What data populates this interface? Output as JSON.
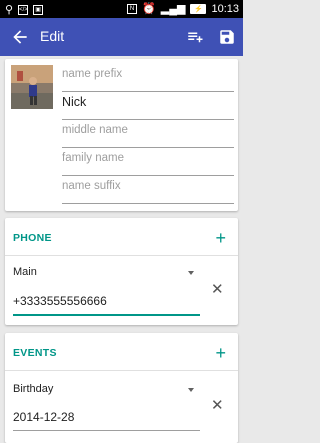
{
  "status": {
    "time": "10:13"
  },
  "toolbar": {
    "title": "Edit"
  },
  "name": {
    "prefix_placeholder": "name prefix",
    "first_value": "Nick",
    "middle_placeholder": "middle name",
    "family_placeholder": "family name",
    "suffix_placeholder": "name suffix"
  },
  "phone": {
    "title": "PHONE",
    "type": "Main",
    "value": "+3333555556666"
  },
  "events": {
    "title": "EVENTS",
    "type": "Birthday",
    "value": "2014-12-28"
  },
  "colors": {
    "primary": "#3f51b5",
    "accent": "#009688"
  },
  "icons": [
    "back-arrow-icon",
    "playlist-add-icon",
    "save-icon",
    "plus-icon",
    "close-icon",
    "chevron-down-icon"
  ]
}
